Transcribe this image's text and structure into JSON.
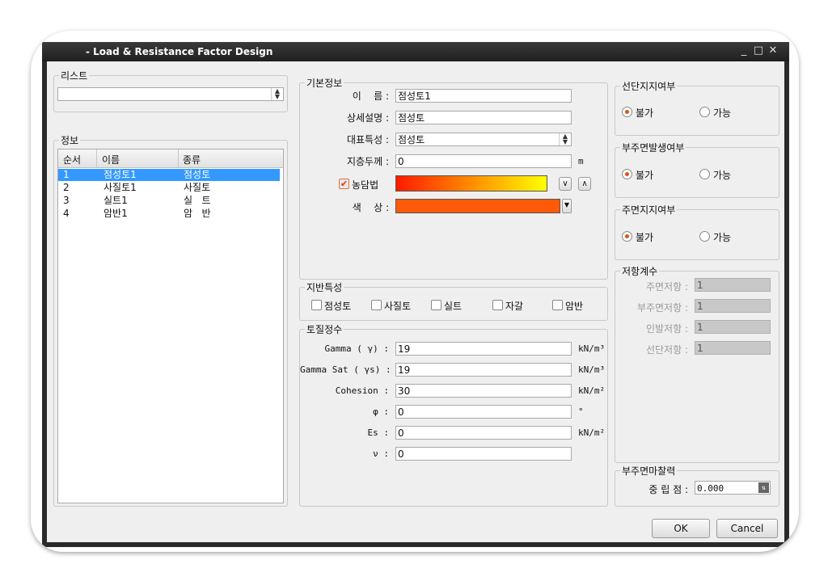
{
  "window": {
    "title": "- Load & Resistance Factor Design",
    "minimize": "_",
    "maximize": "□",
    "close": "✕"
  },
  "list_group": {
    "label": "리스트",
    "value": ""
  },
  "info_group": {
    "label": "정보",
    "columns": [
      "순서",
      "이름",
      "종류"
    ],
    "rows": [
      [
        "1",
        "점성토1",
        "점성토"
      ],
      [
        "2",
        "사질토1",
        "사질토"
      ],
      [
        "3",
        "실트1",
        "실   트"
      ],
      [
        "4",
        "암반1",
        "암   반"
      ]
    ],
    "selected_row": 0
  },
  "basic_info": {
    "label": "기본정보",
    "name_label": "이    름 :",
    "name_value": "점성토1",
    "desc_label": "상세설명 :",
    "desc_value": "점성토",
    "type_label": "대표특성 :",
    "type_value": "점성토",
    "thickness_label": "지층두께 :",
    "thickness_value": "0",
    "thickness_unit": "m",
    "shading_label": "농담법",
    "shading_checked": true,
    "color_label": "색    상 :",
    "gradient_colors": [
      "#ff1a00",
      "#ffff00"
    ],
    "fill_color": "#ff5a0a"
  },
  "ground": {
    "label": "지반특성",
    "options": [
      "점성토",
      "사질토",
      "실트",
      "자갈",
      "암반"
    ]
  },
  "soil": {
    "label": "토질정수",
    "params": [
      {
        "label": "Gamma ( γ) :",
        "value": "19",
        "unit": "kN/m³"
      },
      {
        "label": "Gamma Sat ( γs) :",
        "value": "19",
        "unit": "kN/m³"
      },
      {
        "label": "Cohesion :",
        "value": "30",
        "unit": "kN/m²"
      },
      {
        "label": "φ :",
        "value": "0",
        "unit": "°"
      },
      {
        "label": "Es :",
        "value": "0",
        "unit": "kN/m²"
      },
      {
        "label": "ν :",
        "value": "0",
        "unit": ""
      }
    ]
  },
  "shear_support": {
    "label": "선단지지여부",
    "opt1": "불가",
    "opt2": "가능"
  },
  "neg_friction": {
    "label": "부주면발생여부",
    "opt1": "불가",
    "opt2": "가능"
  },
  "skin_support": {
    "label": "주면지지여부",
    "opt1": "불가",
    "opt2": "가능"
  },
  "resistance": {
    "label": "저항계수",
    "rows": [
      {
        "label": "주면저항 :",
        "value": "1"
      },
      {
        "label": "부주면저항 :",
        "value": "1"
      },
      {
        "label": "인발저항 :",
        "value": "1"
      },
      {
        "label": "선단저항 :",
        "value": "1"
      }
    ]
  },
  "neg_skin": {
    "label": "부주면마찰력",
    "neutral_label": "중 립 점 :",
    "neutral_value": "0.000"
  },
  "buttons": {
    "ok": "OK",
    "cancel": "Cancel"
  },
  "colors": {
    "accent": "#e0501a",
    "selection": "#3399ff"
  }
}
